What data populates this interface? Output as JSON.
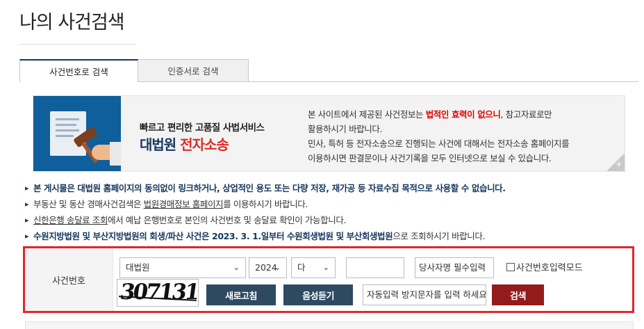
{
  "page": {
    "title": "나의 사건검색"
  },
  "tabs": [
    {
      "label": "사건번호로 검색",
      "active": true
    },
    {
      "label": "인증서로 검색",
      "active": false
    }
  ],
  "banner": {
    "subtitle": "빠르고 편리한 고품질 사법서비스",
    "court": "대법원",
    "service": "전자소송",
    "text": {
      "l1_pre": "본 사이트에서 제공된 사건정보는 ",
      "l1_red": "법적인 효력이 없으니",
      "l1_post": ", 참고자료로만",
      "l2": "활용하시기 바랍니다.",
      "l3": "민사, 특허 등 전자소송으로 진행되는 사건에 대해서는 전자소송 홈페이지를",
      "l4": "이용하시면 판결문이나 사건기록을 모두 인터넷으로 보실 수 있습니다."
    },
    "more": "+"
  },
  "notices": {
    "n1": "본 게시물은 대법원 홈페이지의 동의없이 링크하거나, 상업적인 용도 또는 다량 저장, 재가공 등 자료수집 목적으로 사용할 수 없습니다.",
    "n2_pre": "부동산 및 동산 경매사건검색은 ",
    "n2_link": "법원경매정보 홈페이지",
    "n2_post": "를 이용하시기 바랍니다.",
    "n3_link": "신한은행 송달료 조회",
    "n3_post": "에서 예납 은행번호로 본인의 사건번호 및 송달료 확인이 가능합니다.",
    "n4_pre": "수원지방법원 및 부산지방법원의 회생/파산 사건은 2023. 3. 1.일부터 수원회생법원 및 부산회생법원",
    "n4_post": "으로 조회하시기 바랍니다."
  },
  "search": {
    "label": "사건번호",
    "court_select": "대법원",
    "year_select": "2024",
    "type_select": "다",
    "case_number": "",
    "party_name_placeholder": "당사자명 필수입력",
    "mode_checkbox_label": "사건번호입력모드",
    "captcha_text": "307131",
    "refresh_button": "새로고침",
    "audio_button": "음성듣기",
    "captcha_input_placeholder": "자동입력 방지문자를 입력 하세요",
    "search_button": "검색"
  },
  "colors": {
    "accent_navy": "#17375e",
    "button_navy": "#2e4a62",
    "button_red": "#941b1b",
    "highlight_border": "#e3262b",
    "warning_red": "#e00000"
  }
}
